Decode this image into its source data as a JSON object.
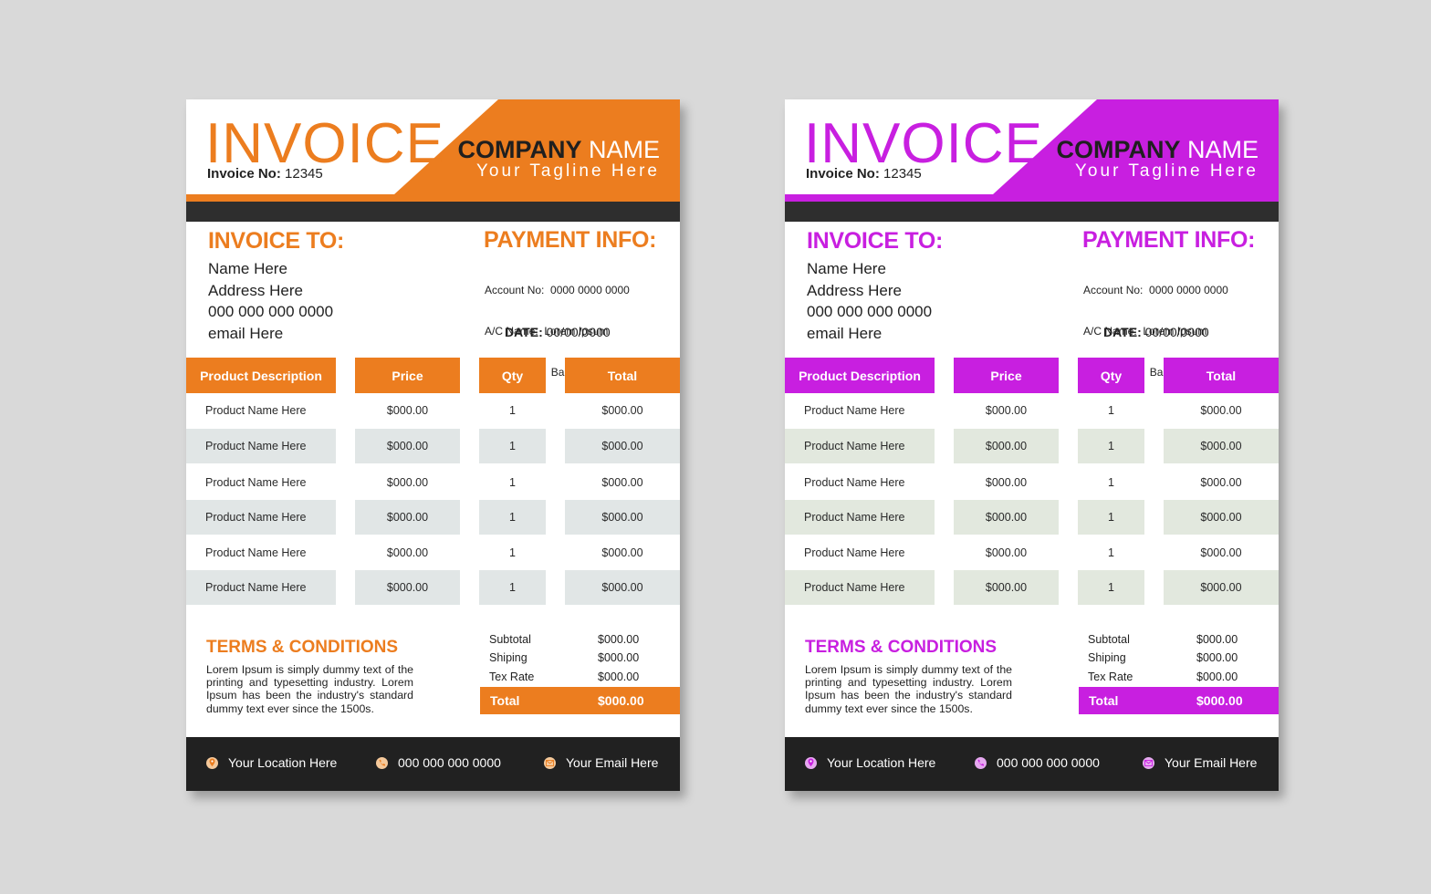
{
  "invoices": [
    {
      "variant": "orange",
      "accent": "#EC7D1F",
      "row_shade": "#E1E6E6",
      "icon_tint": "#F5C99B",
      "title": "INVOICE",
      "invoice_no_label": "Invoice No:",
      "invoice_no": "12345",
      "company_bold": "COMPANY",
      "company_light": "NAME",
      "tagline": "Your Tagline Here",
      "invoice_to": {
        "title": "INVOICE TO:",
        "lines": [
          "Name Here",
          "Address Here",
          "000 000 000 0000",
          "email Here"
        ]
      },
      "payment_info": {
        "title": "PAYMENT INFO:",
        "lines": [
          "Account No:  0000 0000 0000",
          "A/C Name:  Lorem Ipsum",
          "Bank Name:  Bank Name Here"
        ]
      },
      "date_label": "DATE:",
      "date_value": "00/00/0000",
      "table": {
        "headers": [
          "Product Description",
          "Price",
          "Qty",
          "Total"
        ],
        "rows": [
          [
            "Product Name Here",
            "$000.00",
            "1",
            "$000.00"
          ],
          [
            "Product Name Here",
            "$000.00",
            "1",
            "$000.00"
          ],
          [
            "Product Name Here",
            "$000.00",
            "1",
            "$000.00"
          ],
          [
            "Product Name Here",
            "$000.00",
            "1",
            "$000.00"
          ],
          [
            "Product Name Here",
            "$000.00",
            "1",
            "$000.00"
          ],
          [
            "Product Name Here",
            "$000.00",
            "1",
            "$000.00"
          ]
        ]
      },
      "terms": {
        "title": "TERMS & CONDITIONS",
        "text": "Lorem Ipsum is simply dummy text of the printing and typesetting industry. Lorem Ipsum has been the industry's standard dummy text ever since the 1500s."
      },
      "summary": [
        {
          "label": "Subtotal",
          "value": "$000.00"
        },
        {
          "label": "Shiping",
          "value": "$000.00"
        },
        {
          "label": "Tex Rate",
          "value": "$000.00"
        }
      ],
      "total": {
        "label": "Total",
        "value": "$000.00"
      },
      "footer": {
        "location": {
          "icon": "location-pin-icon",
          "text": "Your Location Here"
        },
        "phone": {
          "icon": "phone-icon",
          "text": "000 000 000 0000"
        },
        "email": {
          "icon": "email-icon",
          "text": "Your Email Here"
        }
      }
    },
    {
      "variant": "purple",
      "accent": "#C81FE0",
      "row_shade": "#E2E8DE",
      "icon_tint": "#E6A8F0",
      "title": "INVOICE",
      "invoice_no_label": "Invoice No:",
      "invoice_no": "12345",
      "company_bold": "COMPANY",
      "company_light": "NAME",
      "tagline": "Your Tagline Here",
      "invoice_to": {
        "title": "INVOICE TO:",
        "lines": [
          "Name Here",
          "Address Here",
          "000 000 000 0000",
          "email Here"
        ]
      },
      "payment_info": {
        "title": "PAYMENT INFO:",
        "lines": [
          "Account No:  0000 0000 0000",
          "A/C Name:  Lorem Ipsum",
          "Bank Name:  Bank Name Here"
        ]
      },
      "date_label": "DATE:",
      "date_value": "00/00/0000",
      "table": {
        "headers": [
          "Product Description",
          "Price",
          "Qty",
          "Total"
        ],
        "rows": [
          [
            "Product Name Here",
            "$000.00",
            "1",
            "$000.00"
          ],
          [
            "Product Name Here",
            "$000.00",
            "1",
            "$000.00"
          ],
          [
            "Product Name Here",
            "$000.00",
            "1",
            "$000.00"
          ],
          [
            "Product Name Here",
            "$000.00",
            "1",
            "$000.00"
          ],
          [
            "Product Name Here",
            "$000.00",
            "1",
            "$000.00"
          ],
          [
            "Product Name Here",
            "$000.00",
            "1",
            "$000.00"
          ]
        ]
      },
      "terms": {
        "title": "TERMS & CONDITIONS",
        "text": "Lorem Ipsum is simply dummy text of the printing and typesetting industry. Lorem Ipsum has been the industry's standard dummy text ever since the 1500s."
      },
      "summary": [
        {
          "label": "Subtotal",
          "value": "$000.00"
        },
        {
          "label": "Shiping",
          "value": "$000.00"
        },
        {
          "label": "Tex Rate",
          "value": "$000.00"
        }
      ],
      "total": {
        "label": "Total",
        "value": "$000.00"
      },
      "footer": {
        "location": {
          "icon": "location-pin-icon",
          "text": "Your Location Here"
        },
        "phone": {
          "icon": "phone-icon",
          "text": "000 000 000 0000"
        },
        "email": {
          "icon": "email-icon",
          "text": "Your Email Here"
        }
      }
    }
  ]
}
